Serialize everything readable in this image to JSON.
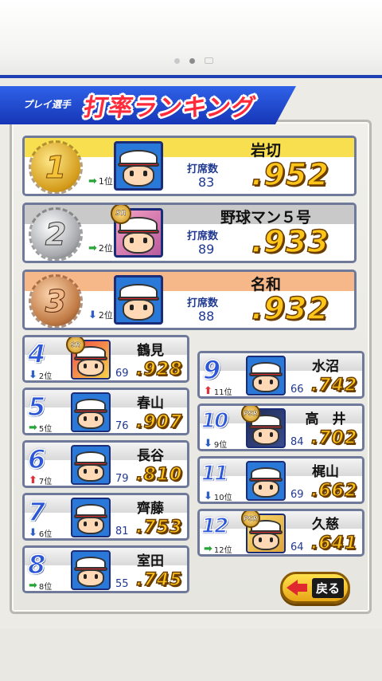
{
  "title": {
    "subtitle": "プレイ選手",
    "main": "打率ランキング"
  },
  "labels": {
    "plate_appearances": "打席数"
  },
  "top3": [
    {
      "rank": "1",
      "name": "岩切",
      "prev": "1位",
      "trend": "right",
      "pa": "83",
      "avg": ".952",
      "band_color": "#f8df4f",
      "badge": ""
    },
    {
      "rank": "2",
      "name": "野球マン５号",
      "prev": "2位",
      "trend": "right",
      "pa": "89",
      "avg": ".933",
      "band_color": "#c9c9c9",
      "badge": "SR"
    },
    {
      "rank": "3",
      "name": "名和",
      "prev": "2位",
      "trend": "down",
      "pa": "88",
      "avg": ".932",
      "band_color": "#f6b889",
      "badge": ""
    }
  ],
  "left_list": [
    {
      "rank": "4",
      "name": "鶴見",
      "prev": "2位",
      "trend": "down",
      "pa": "69",
      "avg": ".928",
      "badge": "SR",
      "avatar": "special2"
    },
    {
      "rank": "5",
      "name": "春山",
      "prev": "5位",
      "trend": "right",
      "pa": "76",
      "avg": ".907",
      "badge": "",
      "avatar": ""
    },
    {
      "rank": "6",
      "name": "長谷",
      "prev": "7位",
      "trend": "up",
      "pa": "79",
      "avg": ".810",
      "badge": "",
      "avatar": ""
    },
    {
      "rank": "7",
      "name": "齊藤",
      "prev": "6位",
      "trend": "down",
      "pa": "81",
      "avg": ".753",
      "badge": "",
      "avatar": ""
    },
    {
      "rank": "8",
      "name": "室田",
      "prev": "8位",
      "trend": "right",
      "pa": "55",
      "avg": ".745",
      "badge": "",
      "avatar": ""
    }
  ],
  "right_list": [
    {
      "rank": "9",
      "name": "水沼",
      "prev": "11位",
      "trend": "up",
      "pa": "66",
      "avg": ".742",
      "badge": "",
      "avatar": ""
    },
    {
      "rank": "10",
      "name": "高　井",
      "prev": "9位",
      "trend": "down",
      "pa": "84",
      "avg": ".702",
      "badge": "PSR",
      "avatar": "special3"
    },
    {
      "rank": "11",
      "name": "梶山",
      "prev": "10位",
      "trend": "down",
      "pa": "69",
      "avg": ".662",
      "badge": "",
      "avatar": ""
    },
    {
      "rank": "12",
      "name": "久慈",
      "prev": "12位",
      "trend": "right",
      "pa": "64",
      "avg": ".641",
      "badge": "PSR",
      "avatar": "special4"
    }
  ],
  "back_button": {
    "label": "戻る"
  },
  "colors": {
    "accent_blue": "#1e3fb3",
    "title_red": "#ff2b3b",
    "avg_gold": "#ffc61a"
  }
}
